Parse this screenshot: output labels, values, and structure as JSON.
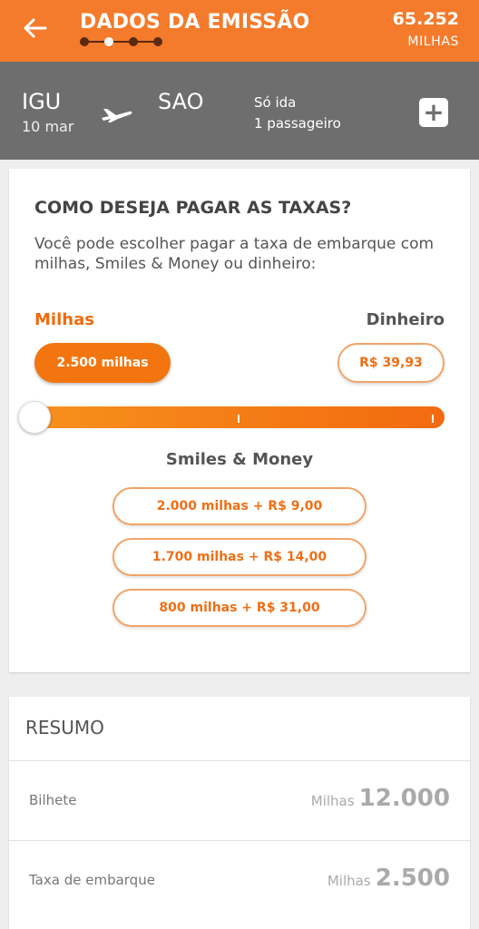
{
  "header": {
    "title": "DADOS DA EMISSÃO",
    "balance": "65.252",
    "balance_unit": "MILHAS",
    "steps_total": 4,
    "active_step": 2
  },
  "flight": {
    "origin_code": "IGU",
    "origin_date": "10 mar",
    "dest_code": "SAO",
    "trip_type": "Só ida",
    "passengers": "1 passageiro",
    "add_label": "+"
  },
  "payment": {
    "question": "COMO DESEJA PAGAR AS TAXAS?",
    "description": "Você pode escolher pagar a taxa de embarque com milhas, Smiles & Money ou dinheiro:",
    "miles_label": "Milhas",
    "cash_label": "Dinheiro",
    "miles_option": "2.500 milhas",
    "cash_option": "R$ 39,93",
    "slider_position": 0,
    "smiles_money_title": "Smiles & Money",
    "smiles_money_options": [
      "2.000 milhas + R$ 9,00",
      "1.700 milhas + R$ 14,00",
      "800 milhas + R$ 31,00"
    ]
  },
  "summary": {
    "title": "RESUMO",
    "rows": [
      {
        "label": "Bilhete",
        "unit": "Milhas",
        "value": "12.000"
      },
      {
        "label": "Taxa de embarque",
        "unit": "Milhas",
        "value": "2.500"
      }
    ]
  },
  "colors": {
    "brand_orange": "#f47b2b",
    "flight_bar_gray": "#6e6e6e"
  }
}
